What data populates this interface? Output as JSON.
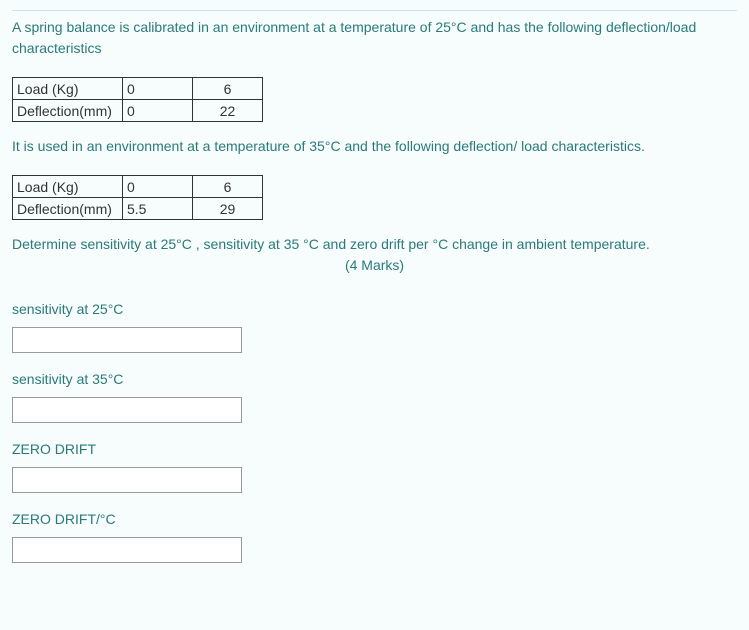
{
  "intro": "A spring balance is calibrated in an environment at a temperature of 25°C and has the following deflection/load characteristics",
  "table1": {
    "row1_label": "Load (Kg)",
    "row1_v1": "0",
    "row1_v2": "6",
    "row2_label": "Deflection(mm)",
    "row2_v1": "0",
    "row2_v2": "22"
  },
  "mid_text": "It is used in an environment at a temperature of 35°C and the following deflection/ load characteristics.",
  "table2": {
    "row1_label": "Load (Kg)",
    "row1_v1": "0",
    "row1_v2": "6",
    "row2_label": "Deflection(mm)",
    "row2_v1": "5.5",
    "row2_v2": "29"
  },
  "determine_text": "Determine sensitivity at 25°C , sensitivity at 35 °C and zero drift per °C  change in ambient temperature.",
  "marks": "(4 Marks)",
  "answers": {
    "a1_label": "sensitivity at 25°C",
    "a2_label": "sensitivity at 35°C",
    "a3_label": "ZERO DRIFT",
    "a4_label": "ZERO DRIFT/°C"
  }
}
